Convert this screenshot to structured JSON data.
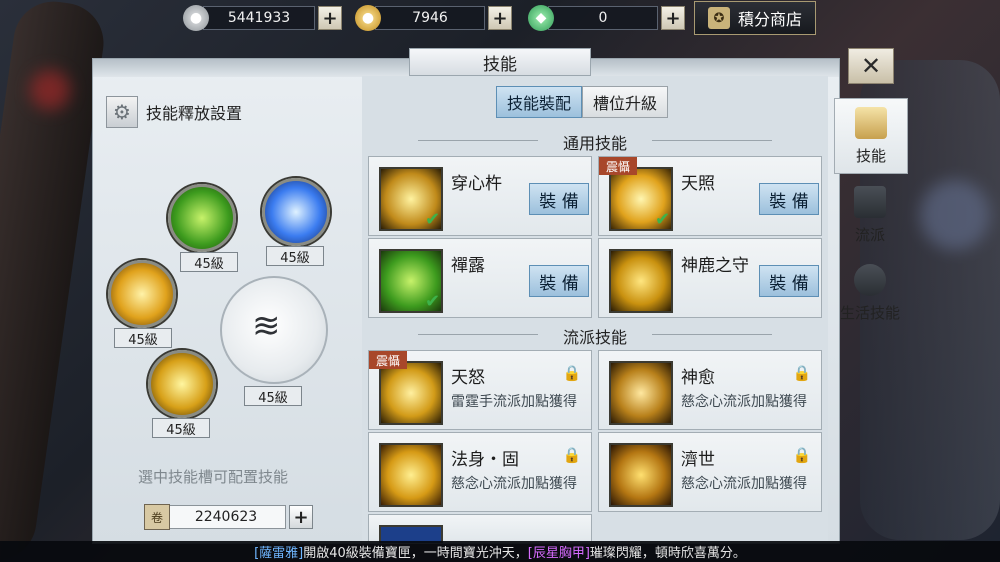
{
  "currency": {
    "silver": {
      "value": "5441933",
      "icon": "silver-coin-icon"
    },
    "gold": {
      "value": "7946",
      "icon": "gold-ingot-icon"
    },
    "jade": {
      "value": "0",
      "icon": "jade-ingot-icon"
    },
    "plus": "+"
  },
  "shop": {
    "label": "積分商店",
    "icon": "shop-icon"
  },
  "panel": {
    "title": "技能",
    "close": "✕"
  },
  "left": {
    "release_setting": "技能釋放設置",
    "hint": "選中技能槽可配置技能",
    "points": "2240623",
    "slots": [
      {
        "level": "45級",
        "icon": "chanlu-skill-icon"
      },
      {
        "level": "45級",
        "icon": "lightning-skill-icon"
      },
      {
        "level": "45級",
        "icon": "tianzhao-skill-icon"
      },
      {
        "level": "45級",
        "icon": "claw-skill-icon"
      },
      {
        "level": "45級",
        "icon": "chuanxin-skill-icon"
      }
    ]
  },
  "center": {
    "tabs": {
      "equip": "技能裝配",
      "slot_upgrade": "槽位升級"
    },
    "general_title": "通用技能",
    "school_title": "流派技能",
    "equip_label": "裝 備",
    "general_skills": [
      {
        "name": "穿心杵",
        "icon": "chuanxin-skill-icon",
        "checked": true
      },
      {
        "name": "天照",
        "icon": "tianzhao-skill-icon",
        "badge": "震懾",
        "checked": true
      },
      {
        "name": "禪露",
        "icon": "chanlu-skill-icon",
        "checked": true
      },
      {
        "name": "神鹿之守",
        "icon": "deer-skill-icon"
      }
    ],
    "school_skills": [
      {
        "name": "天怒",
        "sub": "雷霆手流派加點獲得",
        "icon": "tiannu-skill-icon",
        "badge": "震懾"
      },
      {
        "name": "神愈",
        "sub": "慈念心流派加點獲得",
        "icon": "shenyu-skill-icon"
      },
      {
        "name": "法身・固",
        "sub": "慈念心流派加點獲得",
        "icon": "fashen-skill-icon"
      },
      {
        "name": "濟世",
        "sub": "慈念心流派加點獲得",
        "icon": "jishi-skill-icon"
      }
    ]
  },
  "right_tabs": [
    {
      "label": "技能",
      "icon": "scroll-icon"
    },
    {
      "label": "流派",
      "icon": "book-icon"
    },
    {
      "label": "生活技能",
      "icon": "bowl-icon"
    }
  ],
  "ticker": {
    "part1": "[薩雷雅]",
    "part2": "開啟40級裝備寶匣，一時間寶光沖天，",
    "part3": "[辰星胸甲]",
    "part4": "璀璨閃耀，頓時欣喜萬分。"
  },
  "colors": {
    "accent_blue": "#9cc0dc",
    "gold": "#d9a520",
    "check_green": "#3db34a"
  }
}
